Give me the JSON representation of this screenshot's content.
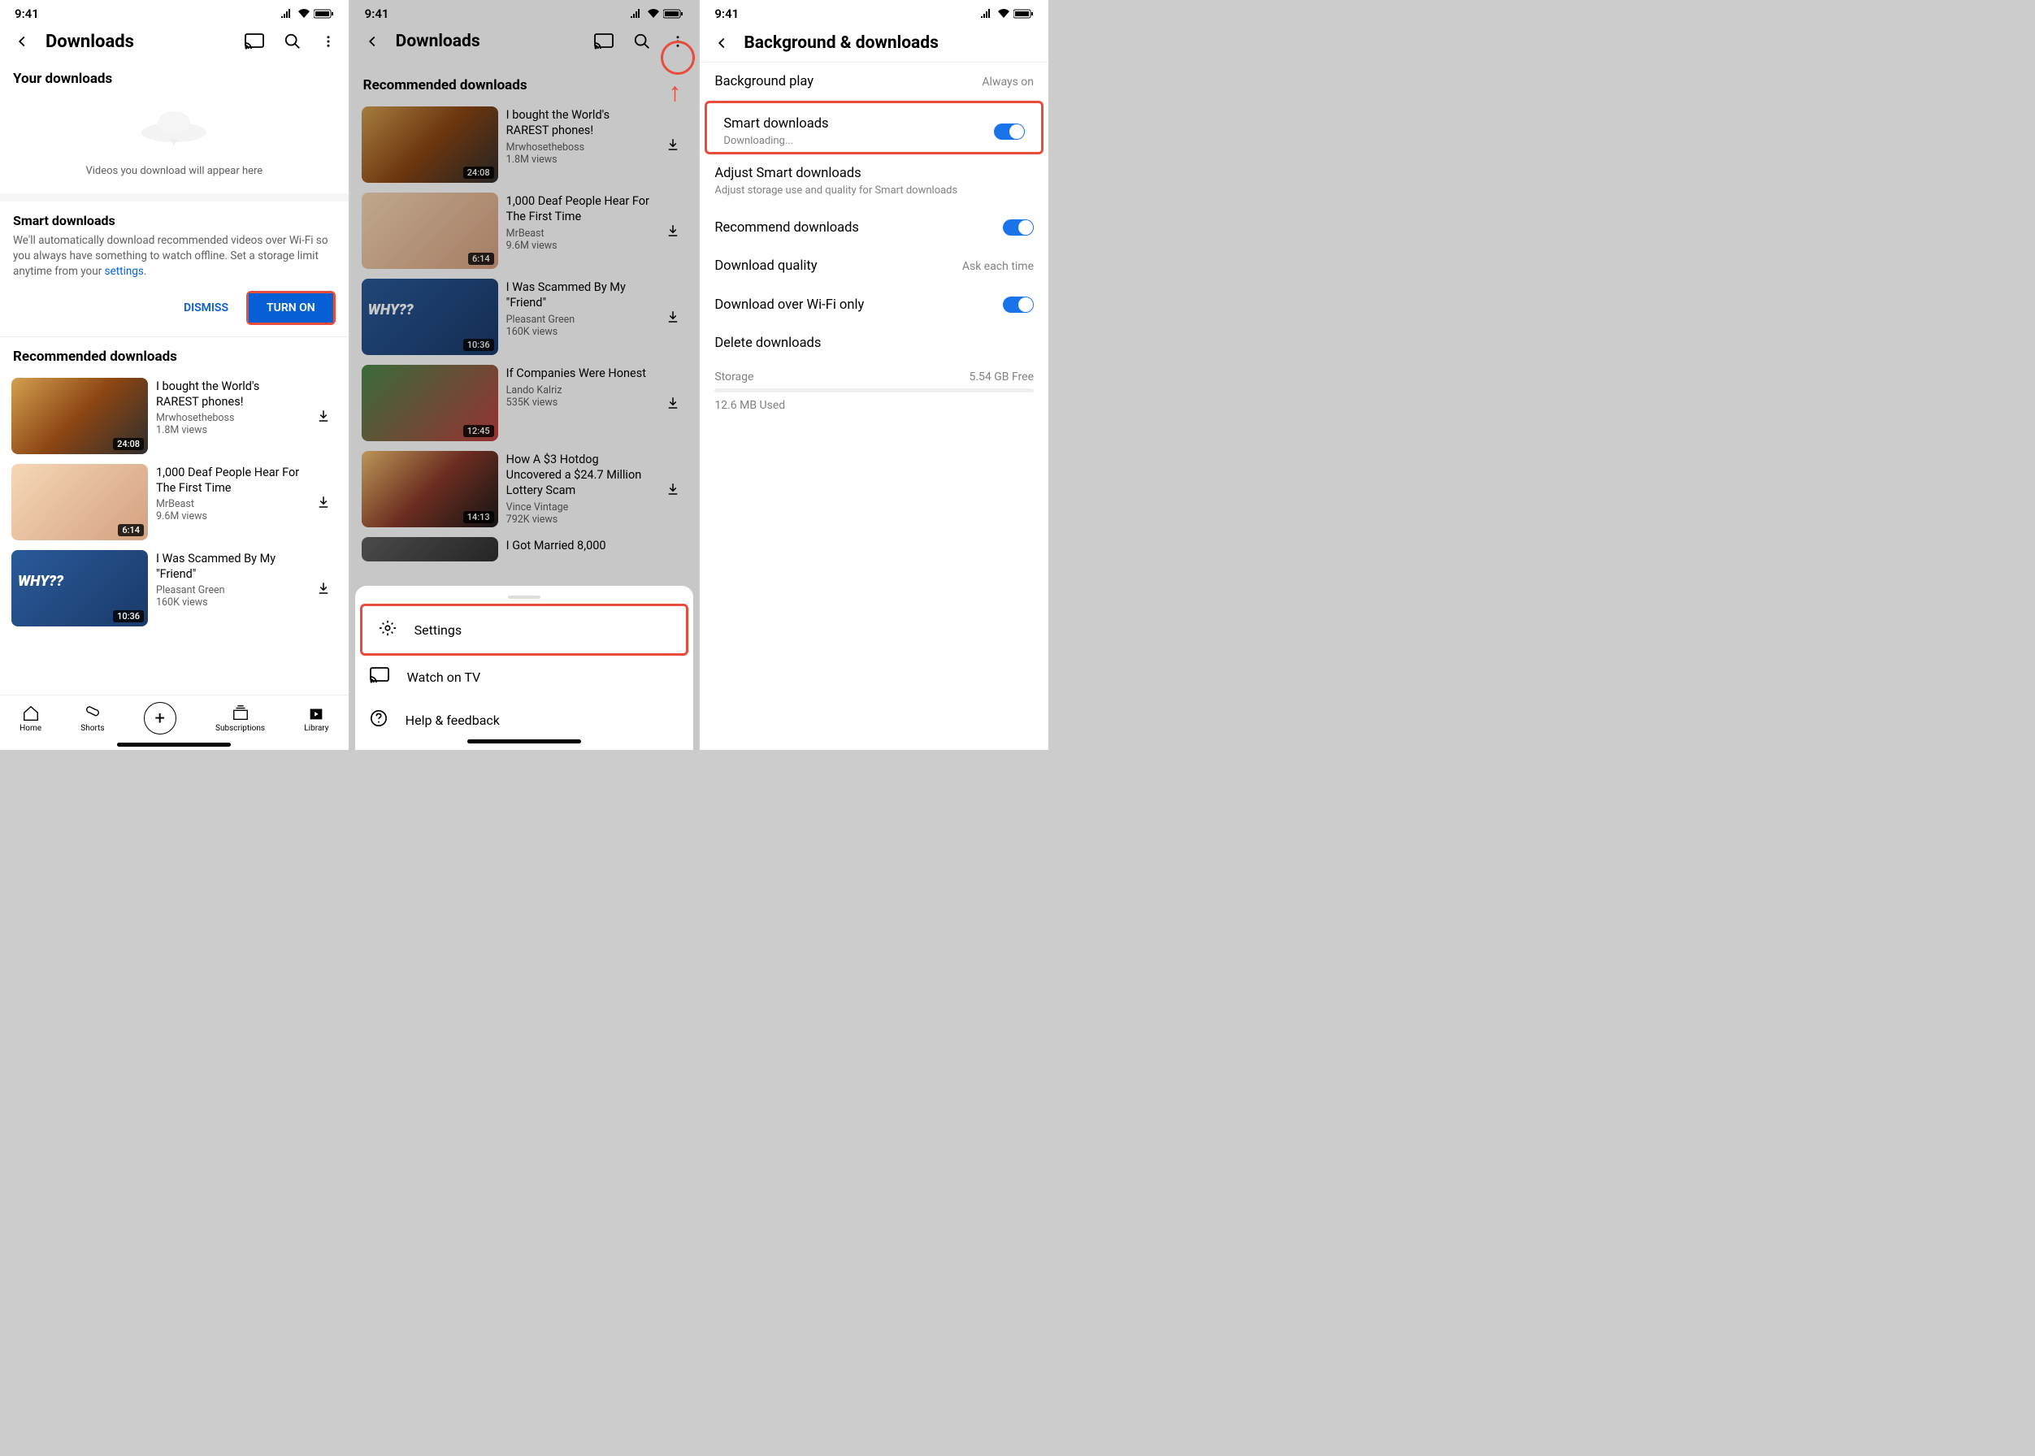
{
  "status": {
    "time": "9:41"
  },
  "screen1": {
    "title": "Downloads",
    "your_downloads": "Your downloads",
    "empty_text": "Videos you download will appear here",
    "smart": {
      "title": "Smart downloads",
      "desc_pre": "We'll automatically download recommended videos over Wi-Fi so you always have something to watch offline. Set a storage limit anytime from your ",
      "settings_link": "settings",
      "dismiss": "DISMISS",
      "turnon": "TURN ON"
    },
    "rec_title": "Recommended downloads",
    "videos": [
      {
        "title": "I bought the World's RAREST phones!",
        "channel": "Mrwhosetheboss",
        "views": "1.8M views",
        "duration": "24:08"
      },
      {
        "title": "1,000 Deaf People Hear For The First Time",
        "channel": "MrBeast",
        "views": "9.6M views",
        "duration": "6:14"
      },
      {
        "title": "I Was Scammed By My \"Friend\"",
        "channel": "Pleasant Green",
        "views": "160K views",
        "duration": "10:36"
      }
    ],
    "nav": {
      "home": "Home",
      "shorts": "Shorts",
      "subs": "Subscriptions",
      "library": "Library"
    }
  },
  "screen2": {
    "title": "Downloads",
    "rec_title": "Recommended downloads",
    "videos": [
      {
        "title": "I bought the World's RAREST phones!",
        "channel": "Mrwhosetheboss",
        "views": "1.8M views",
        "duration": "24:08"
      },
      {
        "title": "1,000 Deaf People Hear For The First Time",
        "channel": "MrBeast",
        "views": "9.6M views",
        "duration": "6:14"
      },
      {
        "title": "I Was Scammed By My \"Friend\"",
        "channel": "Pleasant Green",
        "views": "160K views",
        "duration": "10:36"
      },
      {
        "title": "If Companies Were Honest",
        "channel": "Lando Kalriz",
        "views": "535K views",
        "duration": "12:45"
      },
      {
        "title": "How A $3 Hotdog Uncovered a $24.7 Million Lottery Scam",
        "channel": "Vince Vintage",
        "views": "792K views",
        "duration": "14:13"
      },
      {
        "title": "I Got Married 8,000",
        "channel": "",
        "views": "",
        "duration": ""
      }
    ],
    "popup": {
      "settings": "Settings",
      "watchtv": "Watch on TV",
      "help": "Help & feedback"
    }
  },
  "screen3": {
    "title": "Background & downloads",
    "rows": {
      "bgplay": {
        "label": "Background play",
        "value": "Always on"
      },
      "smart": {
        "label": "Smart downloads",
        "sub": "Downloading..."
      },
      "adjust": {
        "label": "Adjust Smart downloads",
        "sub": "Adjust storage use and quality for Smart downloads"
      },
      "recommend": {
        "label": "Recommend downloads"
      },
      "quality": {
        "label": "Download quality",
        "value": "Ask each time"
      },
      "wifi": {
        "label": "Download over Wi-Fi only"
      },
      "delete": {
        "label": "Delete downloads"
      }
    },
    "storage": {
      "label": "Storage",
      "free": "5.54 GB Free",
      "used": "12.6 MB Used"
    }
  }
}
